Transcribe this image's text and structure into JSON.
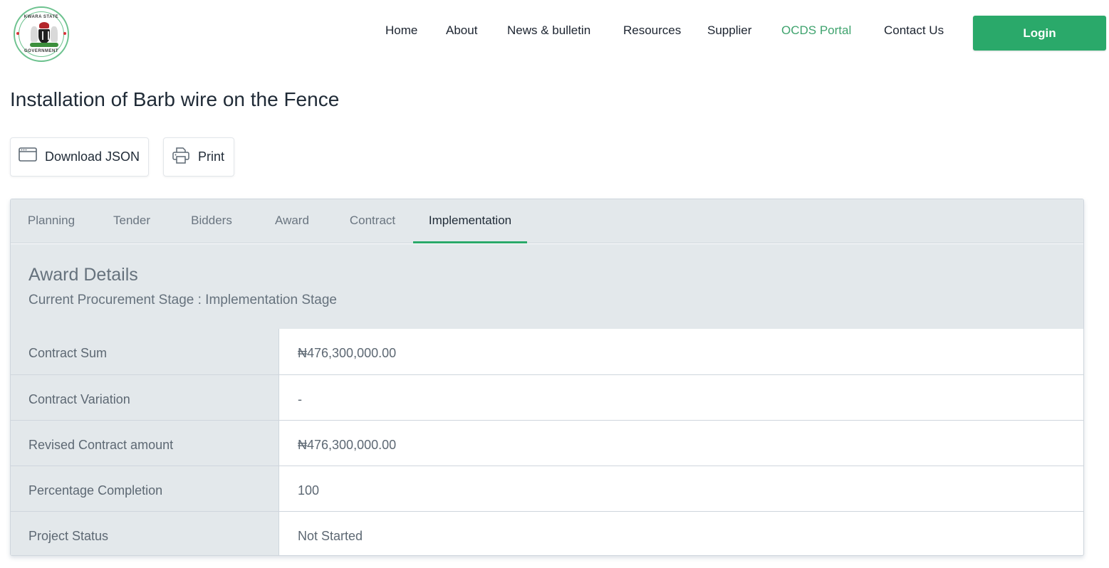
{
  "header": {
    "logo": {
      "alt": "Kwara State Government logo",
      "text_top": "KWARA STATE",
      "text_bottom": "GOVERNMENT"
    },
    "nav": [
      {
        "label": "Home",
        "active": false
      },
      {
        "label": "About",
        "active": false
      },
      {
        "label": "News & bulletin",
        "active": false
      },
      {
        "label": "Resources",
        "active": false
      },
      {
        "label": "Supplier",
        "active": false
      },
      {
        "label": "OCDS Portal",
        "active": true
      },
      {
        "label": "Contact Us",
        "active": false
      }
    ],
    "login_label": "Login"
  },
  "page": {
    "title": "Installation of Barb wire on the Fence",
    "actions": {
      "download_json": {
        "label": "Download JSON",
        "icon": "browser-window-icon"
      },
      "print": {
        "label": "Print",
        "icon": "printer-icon"
      }
    }
  },
  "tabs": [
    {
      "label": "Planning",
      "active": false
    },
    {
      "label": "Tender",
      "active": false
    },
    {
      "label": "Bidders",
      "active": false
    },
    {
      "label": "Award",
      "active": false
    },
    {
      "label": "Contract",
      "active": false
    },
    {
      "label": "Implementation",
      "active": true
    }
  ],
  "section": {
    "title": "Award Details",
    "subtitle": "Current Procurement Stage : Implementation Stage"
  },
  "details": [
    {
      "label": "Contract Sum",
      "value": "₦476,300,000.00"
    },
    {
      "label": "Contract Variation",
      "value": "-"
    },
    {
      "label": "Revised Contract amount",
      "value": "₦476,300,000.00"
    },
    {
      "label": "Percentage Completion",
      "value": "100"
    },
    {
      "label": "Project Status",
      "value": "Not Started"
    }
  ],
  "colors": {
    "brand_green": "#2aa96a",
    "active_nav": "#3fa36e",
    "panel_gray": "#e3e8eb",
    "muted_text": "#5d6873"
  }
}
